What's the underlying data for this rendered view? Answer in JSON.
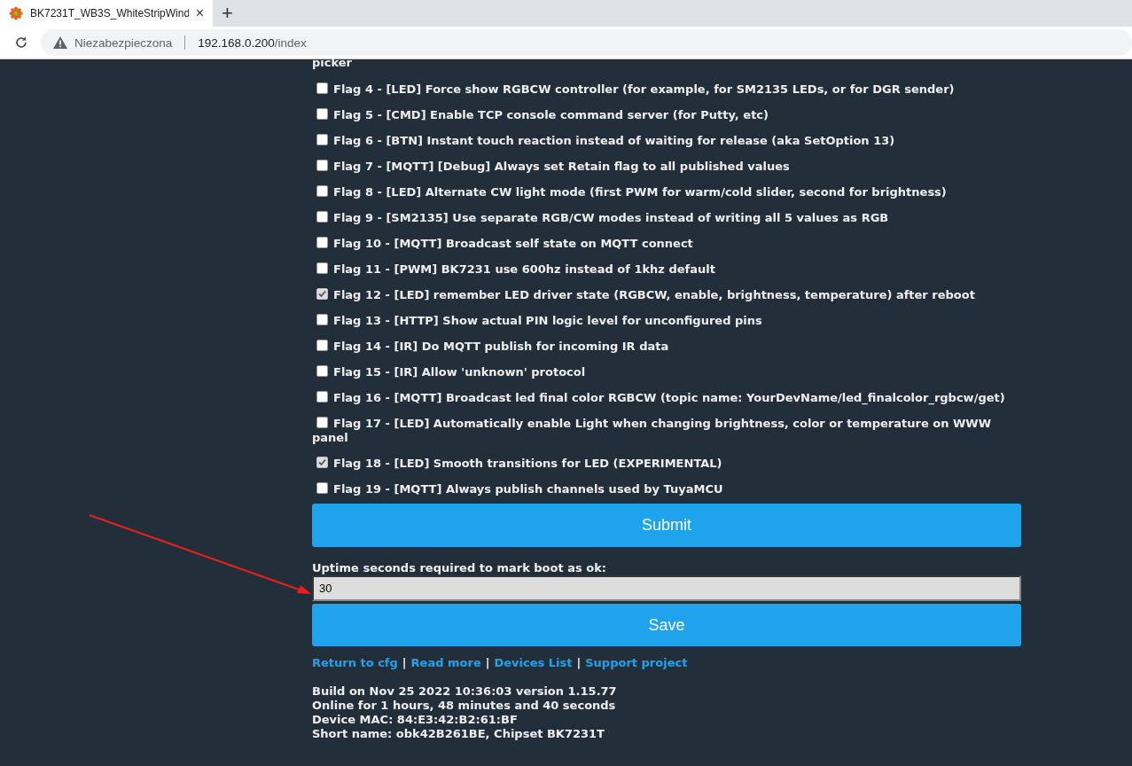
{
  "browser": {
    "tab_title": "BK7231T_WB3S_WhiteStripWind",
    "new_tab": "+",
    "close": "×",
    "security": "Niezabezpieczona",
    "url_host": "192.168.0.200",
    "url_path": "/index"
  },
  "page": {
    "cut_text": "picker",
    "flags": [
      {
        "label": "Flag 4 - [LED] Force show RGBCW controller (for example, for SM2135 LEDs, or for DGR sender)",
        "checked": false
      },
      {
        "label": "Flag 5 - [CMD] Enable TCP console command server (for Putty, etc)",
        "checked": false
      },
      {
        "label": "Flag 6 - [BTN] Instant touch reaction instead of waiting for release (aka SetOption 13)",
        "checked": false
      },
      {
        "label": "Flag 7 - [MQTT] [Debug] Always set Retain flag to all published values",
        "checked": false
      },
      {
        "label": "Flag 8 - [LED] Alternate CW light mode (first PWM for warm/cold slider, second for brightness)",
        "checked": false
      },
      {
        "label": "Flag 9 - [SM2135] Use separate RGB/CW modes instead of writing all 5 values as RGB",
        "checked": false
      },
      {
        "label": "Flag 10 - [MQTT] Broadcast self state on MQTT connect",
        "checked": false
      },
      {
        "label": "Flag 11 - [PWM] BK7231 use 600hz instead of 1khz default",
        "checked": false
      },
      {
        "label": "Flag 12 - [LED] remember LED driver state (RGBCW, enable, brightness, temperature) after reboot",
        "checked": true
      },
      {
        "label": "Flag 13 - [HTTP] Show actual PIN logic level for unconfigured pins",
        "checked": false
      },
      {
        "label": "Flag 14 - [IR] Do MQTT publish for incoming IR data",
        "checked": false
      },
      {
        "label": "Flag 15 - [IR] Allow 'unknown' protocol",
        "checked": false
      },
      {
        "label": "Flag 16 - [MQTT] Broadcast led final color RGBCW (topic name: YourDevName/led_finalcolor_rgbcw/get)",
        "checked": false
      },
      {
        "label": "Flag 17 - [LED] Automatically enable Light when changing brightness, color or temperature on WWW panel",
        "checked": false
      },
      {
        "label": "Flag 18 - [LED] Smooth transitions for LED (EXPERIMENTAL)",
        "checked": true
      },
      {
        "label": "Flag 19 - [MQTT] Always publish channels used by TuyaMCU",
        "checked": false
      }
    ],
    "submit": "Submit",
    "uptime_label": "Uptime seconds required to mark boot as ok:",
    "uptime_value": "30",
    "save": "Save",
    "footer_links": [
      {
        "kind": "link",
        "text": "Return to cfg"
      },
      {
        "kind": "separator",
        "text": "|"
      },
      {
        "kind": "link",
        "text": "Read more"
      },
      {
        "kind": "separator",
        "text": "|"
      },
      {
        "kind": "link",
        "text": "Devices List"
      },
      {
        "kind": "separator",
        "text": "|"
      },
      {
        "kind": "link",
        "text": "Support project"
      }
    ],
    "info": [
      "Build on Nov 25 2022 10:36:03 version 1.15.77",
      "Online for 1 hours, 48 minutes and 40 seconds",
      "Device MAC: 84:E3:42:B2:61:BF",
      "Short name: obk42B261BE, Chipset BK7231T"
    ]
  }
}
